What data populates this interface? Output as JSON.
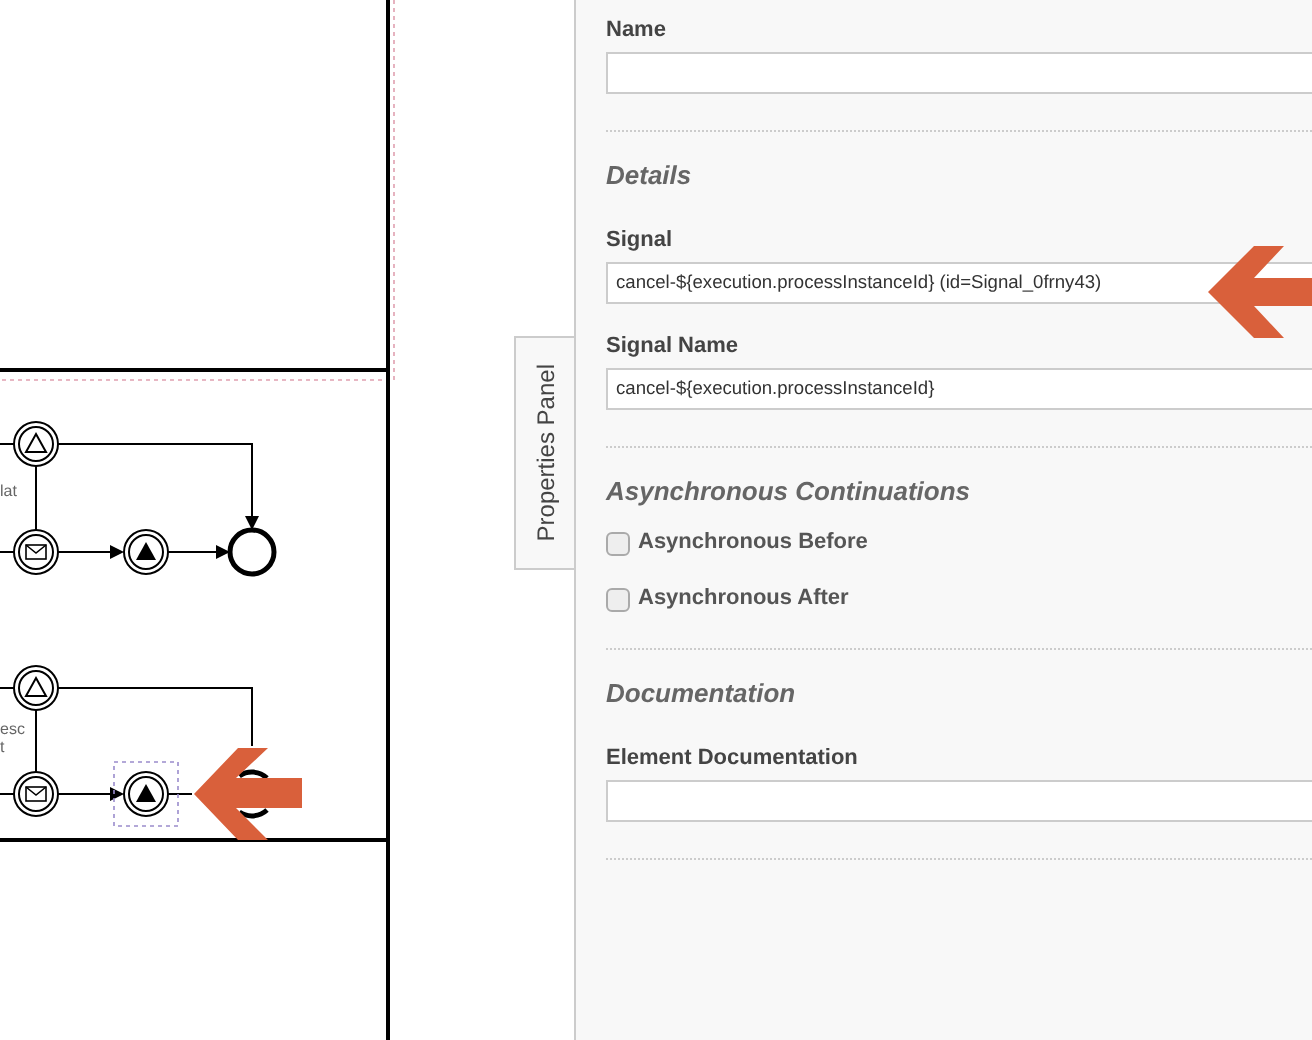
{
  "canvas": {
    "labels": [
      "lat",
      "esc",
      "t"
    ]
  },
  "panel_tab": {
    "label": "Properties Panel"
  },
  "sections": [
    {
      "fields": [
        {
          "label": "Name"
        }
      ]
    },
    {
      "title": "Details",
      "fields": [
        {
          "label": "Signal",
          "value": "cancel-${execution.processInstanceId} (id=Signal_0frny43)"
        },
        {
          "label": "Signal Name",
          "value": "cancel-${execution.processInstanceId}"
        }
      ]
    },
    {
      "title": "Asynchronous Continuations",
      "checkboxes": [
        {
          "label": "Asynchronous Before",
          "checked": false
        },
        {
          "label": "Asynchronous After",
          "checked": false
        }
      ]
    },
    {
      "title": "Documentation",
      "fields": [
        {
          "label": "Element Documentation"
        }
      ]
    }
  ]
}
